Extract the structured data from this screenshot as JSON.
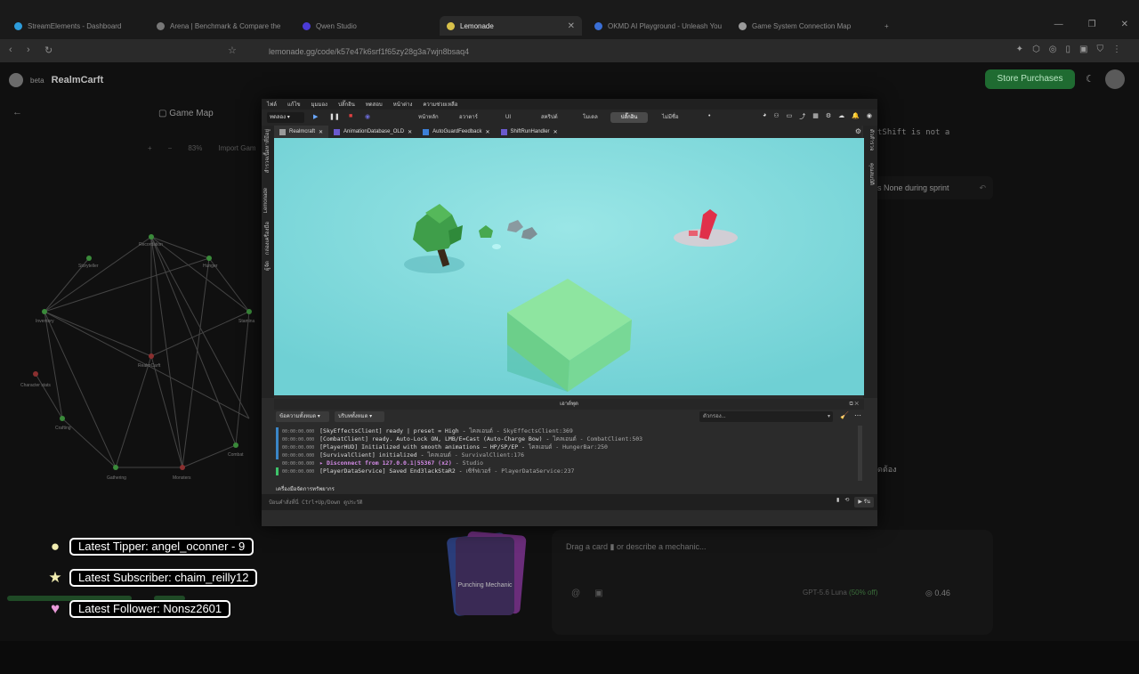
{
  "browser": {
    "tabs": [
      {
        "title": "StreamElements - Dashboard",
        "active": false
      },
      {
        "title": "Arena | Benchmark & Compare the",
        "active": false
      },
      {
        "title": "Qwen Studio",
        "active": false
      },
      {
        "title": "Lemonade",
        "active": true
      },
      {
        "title": "OKMD AI Playground - Unleash You",
        "active": false
      },
      {
        "title": "Game System Connection Map",
        "active": false
      }
    ],
    "url": "lemonade.gg/code/k57e47k6srf1f65zy28g3a7wjn8bsaq4"
  },
  "page": {
    "beta": "beta",
    "project_name": "RealmCarft",
    "store_button": "Store Purchases",
    "game_map_title": "Game Map",
    "map_zoom": "83%",
    "import_label": "Import Gam",
    "right_code_snippet": "tShift is not a",
    "right_pill_text": "s None during sprint",
    "right_thai_text": "ดต้อง",
    "composer_placeholder": "Drag a card ▮ or describe a mechanic...",
    "model_label": "GPT-5.6 Luna",
    "model_discount": "(50% off)",
    "credits": "0.46",
    "card_label": "Punching Mechanic",
    "graph_nodes": [
      {
        "label": "Storyteller"
      },
      {
        "label": "Recordation"
      },
      {
        "label": "Hunger"
      },
      {
        "label": "Inventory"
      },
      {
        "label": "RealmCarft"
      },
      {
        "label": "Stamina"
      },
      {
        "label": "Character stats"
      },
      {
        "label": "Crafting"
      },
      {
        "label": "Combat"
      },
      {
        "label": "Gathering"
      },
      {
        "label": "Monsters"
      }
    ]
  },
  "studio": {
    "menu": [
      "ไฟล์",
      "แก้ไข",
      "มุมมอง",
      "ปลั๊กอิน",
      "ทดสอบ",
      "หน้าต่าง",
      "ความช่วยเหลือ"
    ],
    "test_dropdown": "ทดลอง",
    "ribbon_tabs": [
      {
        "label": "หน้าหลัก",
        "active": false
      },
      {
        "label": "อวาตาร์",
        "active": false
      },
      {
        "label": "UI",
        "active": false
      },
      {
        "label": "สคริปต์",
        "active": false
      },
      {
        "label": "โมเดล",
        "active": false
      },
      {
        "label": "ปลั๊กอิน",
        "active": true
      },
      {
        "label": "ไม่มีชื่อ",
        "active": false
      }
    ],
    "doc_tabs": [
      {
        "label": "Realmcraft",
        "kind": "place",
        "active": true
      },
      {
        "label": "AnimationDatabase_OLD",
        "kind": "module",
        "active": false
      },
      {
        "label": "AutoGuardFeedback",
        "kind": "script",
        "active": false
      },
      {
        "label": "ShiftRunHandler",
        "kind": "module",
        "active": false
      }
    ],
    "left_rail": [
      "สำรวจเนื้อหาที่มีอยู่",
      "Lemonade",
      "กล่องเครื่องมือ",
      "ผู้จัด"
    ],
    "right_rail": [
      "ตัวสำรวจ",
      "คุณสมบัติ"
    ],
    "output": {
      "title": "เอาต์พุต",
      "filter_all_messages": "ข้อความทั้งหมด",
      "filter_all_contexts": "บริบททั้งหมด",
      "filter_placeholder": "ตัวกรอง...",
      "lines": [
        {
          "ts": "00:00:00.000",
          "msg": "[SkyEffectsClient] ready | preset = High  -  ",
          "src_prefix": "ไคลเอนต์",
          "src": " - SkyEffectsClient:369",
          "color": "#3a86c8",
          "kind": "info"
        },
        {
          "ts": "00:00:00.000",
          "msg": "[CombatClient] ready. Auto-Lock ON, LMB/E=Cast (Auto-Charge Bow)  -  ",
          "src_prefix": "ไคลเอนต์",
          "src": " - CombatClient:503",
          "color": "#3a86c8",
          "kind": "info"
        },
        {
          "ts": "00:00:00.000",
          "msg": "[PlayerHUD] Initialized with smooth animations — HP/SP/EP  -  ",
          "src_prefix": "ไคลเอนต์",
          "src": " - HungerBar:250",
          "color": "#3a86c8",
          "kind": "info"
        },
        {
          "ts": "00:00:00.000",
          "msg": "[SurvivalClient] initialized  -  ",
          "src_prefix": "ไคลเอนต์",
          "src": " - SurvivalClient:176",
          "color": "#3a86c8",
          "kind": "info"
        },
        {
          "ts": "00:00:00.000",
          "msg": "▸ Disconnect from 127.0.0.1|55367 (x2)",
          "src_prefix": "",
          "src": "  -  Studio",
          "color": "",
          "kind": "err"
        },
        {
          "ts": "00:00:00.000",
          "msg": "[PlayerDataService] Saved End3lackStaR2  -  ",
          "src_prefix": "เซิร์ฟเวอร์",
          "src": " - PlayerDataService:237",
          "color": "#3ec36a",
          "kind": "info"
        }
      ]
    },
    "resources_label": "เครื่องมือจัดการทรัพยากร",
    "command_placeholder": "ป้อนคำสั่งที่นี่  Ctrl+Up/Down  ดูประวัติ",
    "run_label": "▶ รัน"
  },
  "overlays": [
    {
      "icon": "coin-icon",
      "glyph": "●",
      "color": "#f1ecb0",
      "text": "Latest Tipper: angel_oconner -  9"
    },
    {
      "icon": "star-icon",
      "glyph": "★",
      "color": "#f1ecb0",
      "text": "Latest Subscriber: chaim_reilly12"
    },
    {
      "icon": "heart-icon",
      "glyph": "♥",
      "color": "#e99ad8",
      "text": "Latest Follower: Nonsz2601"
    }
  ]
}
